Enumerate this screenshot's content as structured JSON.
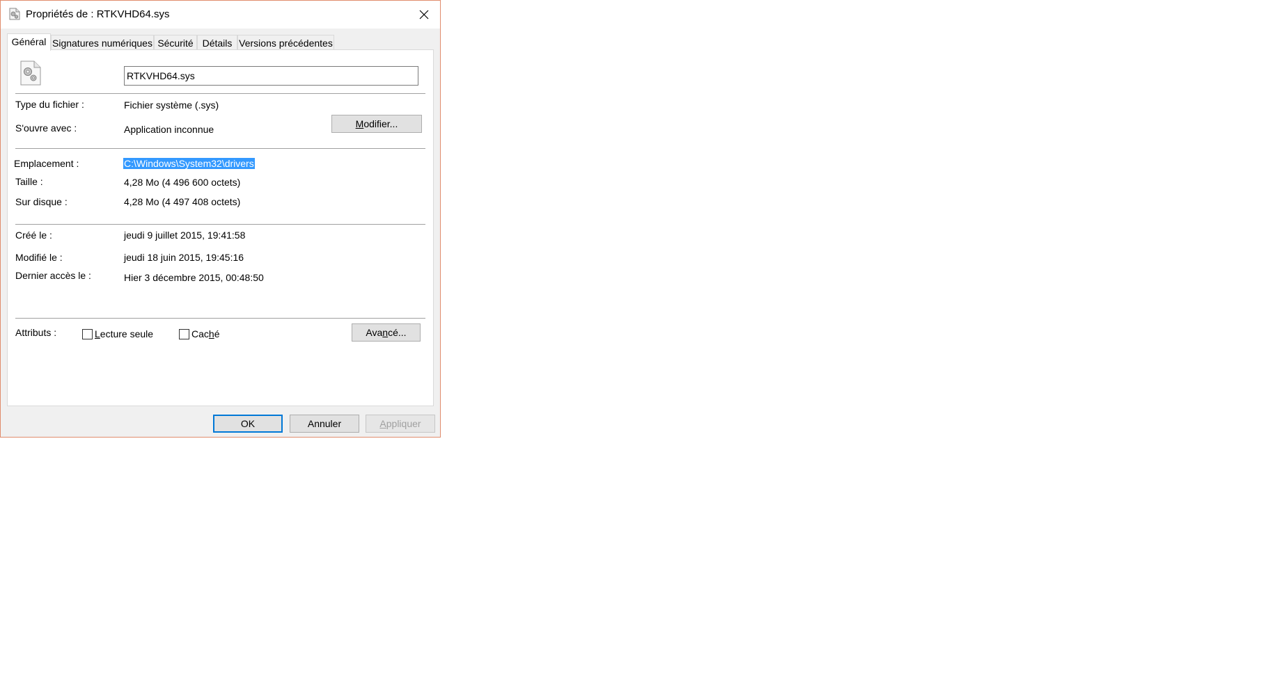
{
  "window": {
    "title": "Propriétés de : RTKVHD64.sys",
    "frame_color": "#e08c6c"
  },
  "tabs": [
    {
      "label": "Général",
      "active": true
    },
    {
      "label": "Signatures numériques",
      "active": false
    },
    {
      "label": "Sécurité",
      "active": false
    },
    {
      "label": "Détails",
      "active": false
    },
    {
      "label": "Versions précédentes",
      "active": false
    }
  ],
  "general": {
    "file_name": "RTKVHD64.sys",
    "type_label": "Type du fichier :",
    "type_value": "Fichier système (.sys)",
    "opens_with_label": "S'ouvre avec :",
    "opens_with_value": "Application inconnue",
    "change_button": {
      "accel": "M",
      "rest": "odifier..."
    },
    "location_label": "Emplacement :",
    "location_value": "C:\\Windows\\System32\\drivers",
    "size_label": "Taille :",
    "size_value": "4,28 Mo (4 496 600 octets)",
    "disk_size_label": "Sur disque :",
    "disk_size_value": "4,28 Mo (4 497 408 octets)",
    "created_label": "Créé le :",
    "created_value": "jeudi 9 juillet 2015, 19:41:58",
    "modified_label": "Modifié le :",
    "modified_value": "jeudi 18 juin 2015, 19:45:16",
    "accessed_label": "Dernier accès le :",
    "accessed_value": "Hier 3 décembre 2015, 00:48:50",
    "attributes_label": "Attributs :",
    "readonly": {
      "accel": "L",
      "rest": "ecture seule",
      "checked": false
    },
    "hidden": {
      "pre": "Cac",
      "accel": "h",
      "rest": "é",
      "checked": false
    },
    "advanced_button": {
      "pre": "Ava",
      "accel": "n",
      "rest": "cé..."
    }
  },
  "footer": {
    "ok": "OK",
    "cancel": "Annuler",
    "apply": {
      "accel": "A",
      "rest": "ppliquer",
      "disabled": true
    }
  },
  "colors": {
    "selection": "#3399ff",
    "default_button_border": "#0078d7"
  },
  "icons": {
    "title": "system-file-gear-icon",
    "file": "system-file-gear-icon",
    "close": "close-icon"
  }
}
